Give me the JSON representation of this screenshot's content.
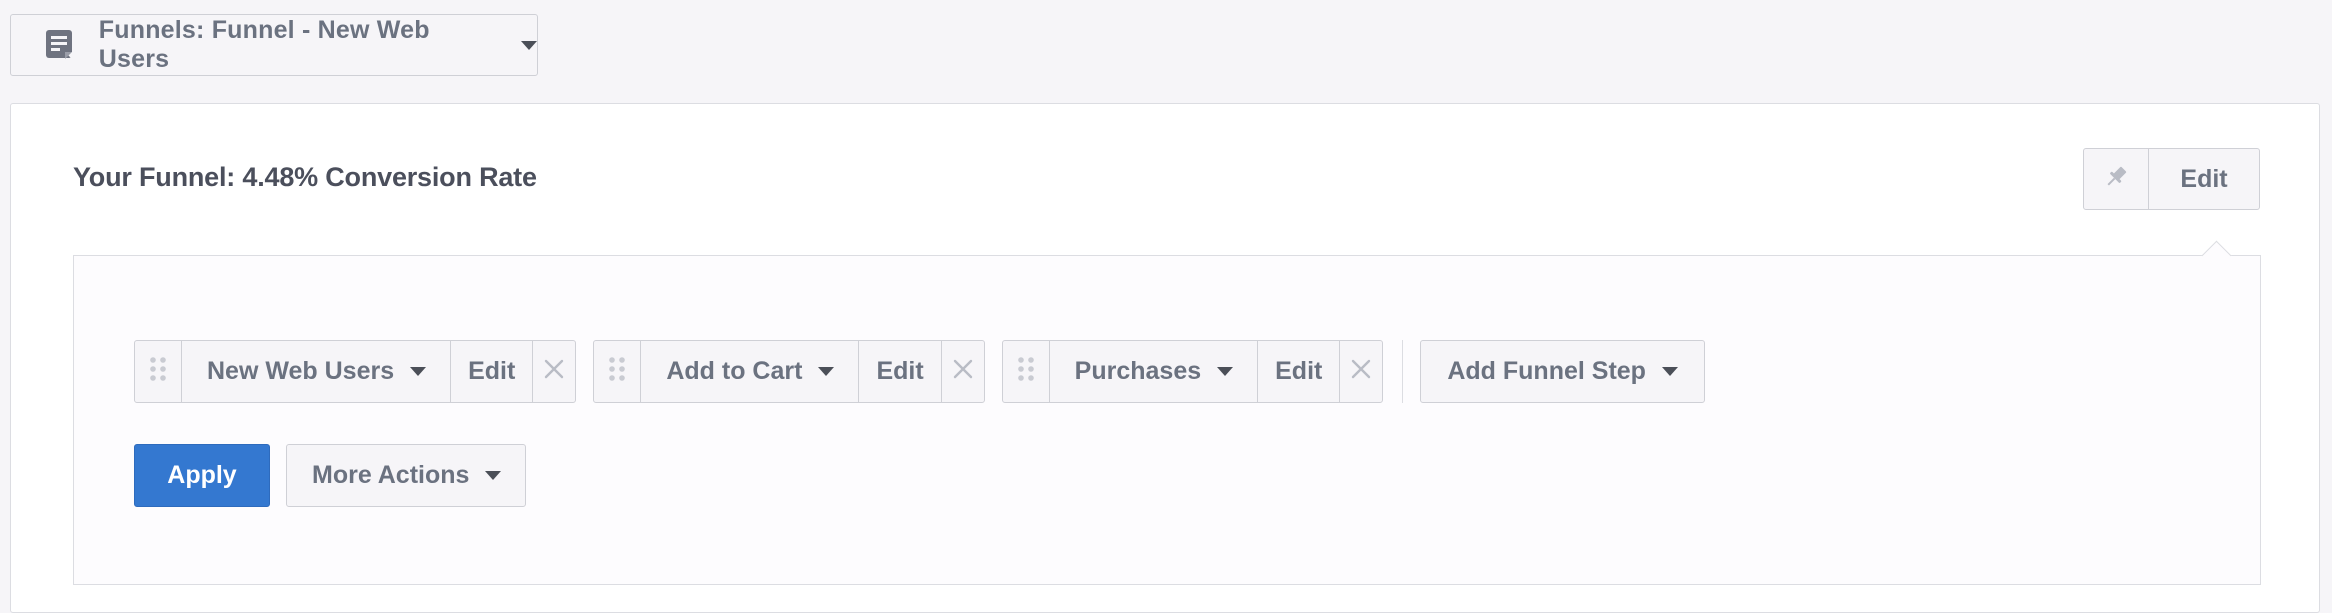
{
  "selector": {
    "icon": "document-icon",
    "label": "Funnels: Funnel - New Web Users"
  },
  "panel": {
    "title": "Your Funnel: 4.48% Conversion Rate",
    "pin_icon": "pin-icon",
    "edit_label": "Edit"
  },
  "steps": [
    {
      "name": "New Web Users",
      "edit_label": "Edit"
    },
    {
      "name": "Add to Cart",
      "edit_label": "Edit"
    },
    {
      "name": "Purchases",
      "edit_label": "Edit"
    }
  ],
  "add_step_label": "Add Funnel Step",
  "actions": {
    "apply_label": "Apply",
    "more_label": "More Actions"
  },
  "colors": {
    "primary": "#3478d0",
    "background": "#f6f5f8",
    "text": "#6b7280",
    "title": "#4b4f5c"
  }
}
